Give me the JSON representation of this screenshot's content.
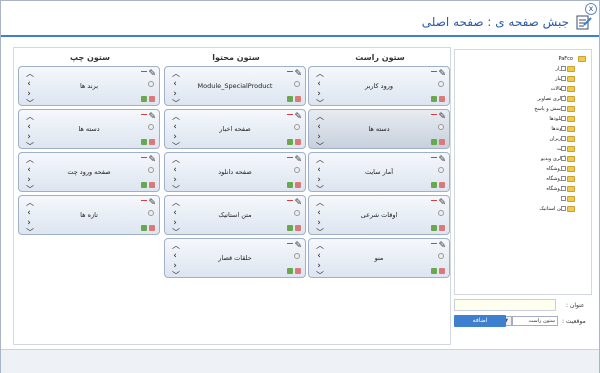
{
  "dialog": {
    "title": "جبش صفحه ی : صفحه اصلی",
    "close_label": "x"
  },
  "columns": [
    {
      "title": "ستون راست",
      "cards": [
        {
          "label": "ورود کاربر",
          "selected": false
        },
        {
          "label": "دسته ها",
          "selected": true
        },
        {
          "label": "آمار سایت",
          "selected": false
        },
        {
          "label": "اوقات شرعی",
          "selected": false
        },
        {
          "label": "منو",
          "selected": false
        }
      ]
    },
    {
      "title": "ستون محتوا",
      "cards": [
        {
          "label": "Module_SpecialProduct",
          "selected": false
        },
        {
          "label": "صفحه اخبار",
          "selected": false
        },
        {
          "label": "صفحه دانلود",
          "selected": false
        },
        {
          "label": "متن استاتیک",
          "selected": false
        },
        {
          "label": "حلقات قصار",
          "selected": false
        }
      ]
    },
    {
      "title": "ستون چپ",
      "cards": [
        {
          "label": "برند ها",
          "selected": false
        },
        {
          "label": "دسته ها",
          "selected": false
        },
        {
          "label": "صفحه ورود چت",
          "selected": false
        },
        {
          "label": "تازه ها",
          "selected": false
        }
      ]
    }
  ],
  "tree": {
    "root": "PaFco",
    "items": [
      "ابزار",
      "اخبار",
      "مقالات",
      "گالری تصاویر",
      "پرسش و پاسخ",
      "دانلودها",
      "پیوندها",
      "کاربران",
      "چت",
      "گالری ویدیو",
      "فروشگاه",
      "فروشگاه",
      "فروشگاه",
      "2",
      "متن استاتیک"
    ]
  },
  "form": {
    "title_label": "عنوان :",
    "title_value": "",
    "position_label": "موقعیت :",
    "position_value": "ستون راست",
    "add_button": "اضافه"
  },
  "colors": {
    "accent": "#3f7fd0",
    "folder": "#f2c94c"
  }
}
